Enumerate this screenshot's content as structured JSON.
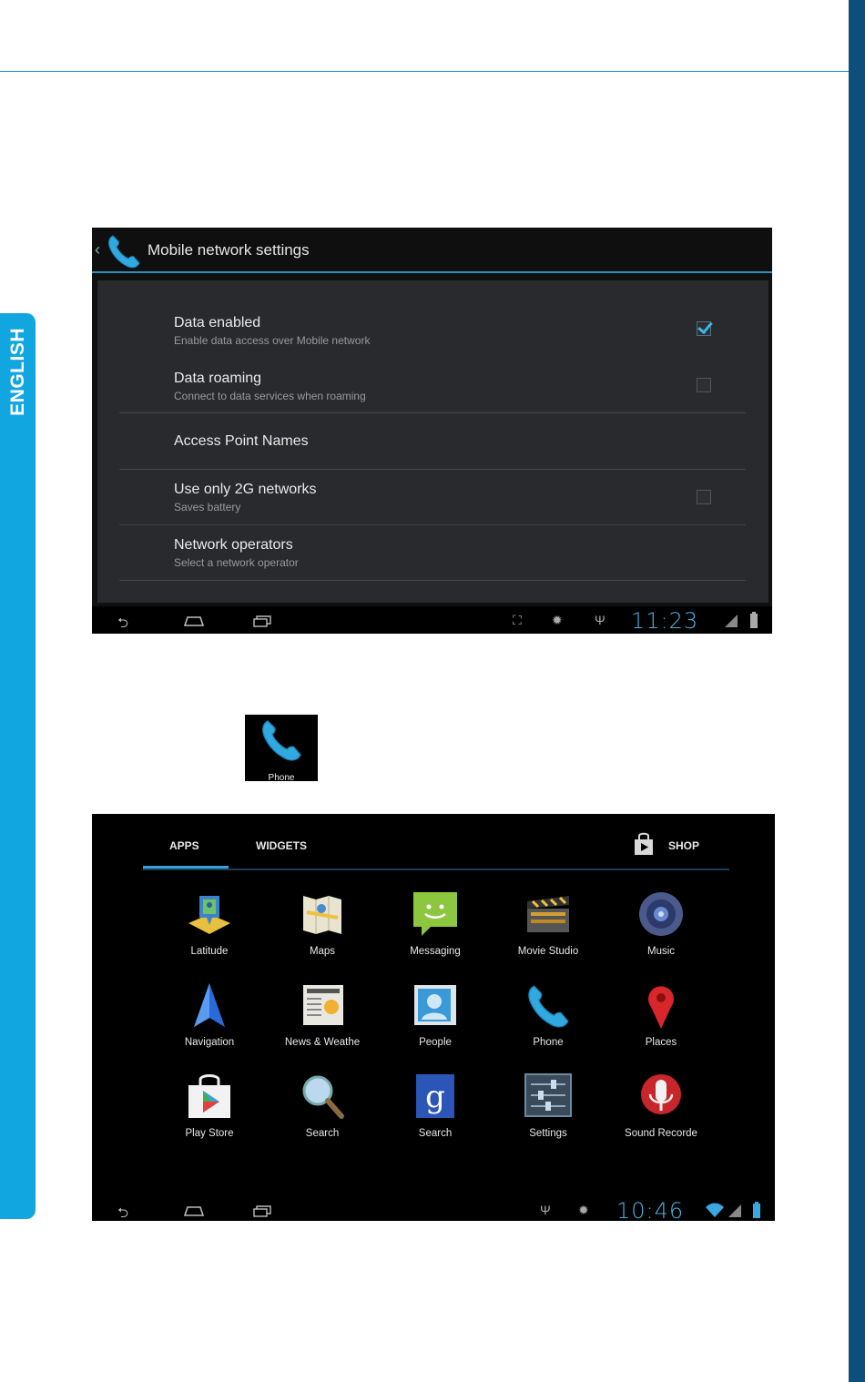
{
  "side_tab": {
    "label": "ENGLISH"
  },
  "screenshot1": {
    "back_glyph": "‹",
    "title": "Mobile network settings",
    "preferences": [
      {
        "title": "Data enabled",
        "summary": "Enable data access over Mobile network",
        "checked": true
      },
      {
        "title": "Data roaming",
        "summary": "Connect to data services when roaming",
        "checked": false
      },
      {
        "title": "Access Point Names",
        "summary": ""
      },
      {
        "title": "Use only 2G networks",
        "summary": "Saves battery",
        "checked": false
      },
      {
        "title": "Network operators",
        "summary": "Select a network operator"
      }
    ],
    "status_bar": {
      "time": "11:23"
    }
  },
  "phone_icon": {
    "label": "Phone"
  },
  "screenshot2": {
    "tabs": {
      "apps": "APPS",
      "widgets": "WIDGETS",
      "shop": "SHOP"
    },
    "apps": [
      {
        "label": "Latitude",
        "icon": "latitude-icon"
      },
      {
        "label": "Maps",
        "icon": "maps-icon"
      },
      {
        "label": "Messaging",
        "icon": "messaging-icon"
      },
      {
        "label": "Movie Studio",
        "icon": "movie-studio-icon"
      },
      {
        "label": "Music",
        "icon": "music-icon"
      },
      {
        "label": "Navigation",
        "icon": "navigation-icon"
      },
      {
        "label": "News & Weathe",
        "icon": "news-weather-icon"
      },
      {
        "label": "People",
        "icon": "people-icon"
      },
      {
        "label": "Phone",
        "icon": "phone-icon"
      },
      {
        "label": "Places",
        "icon": "places-icon"
      },
      {
        "label": "Play Store",
        "icon": "play-store-icon"
      },
      {
        "label": "Search",
        "icon": "search-icon"
      },
      {
        "label": "Search",
        "icon": "google-search-icon"
      },
      {
        "label": "Settings",
        "icon": "settings-icon"
      },
      {
        "label": "Sound Recorde",
        "icon": "sound-recorder-icon"
      }
    ],
    "status_bar": {
      "time": "10:46"
    }
  }
}
